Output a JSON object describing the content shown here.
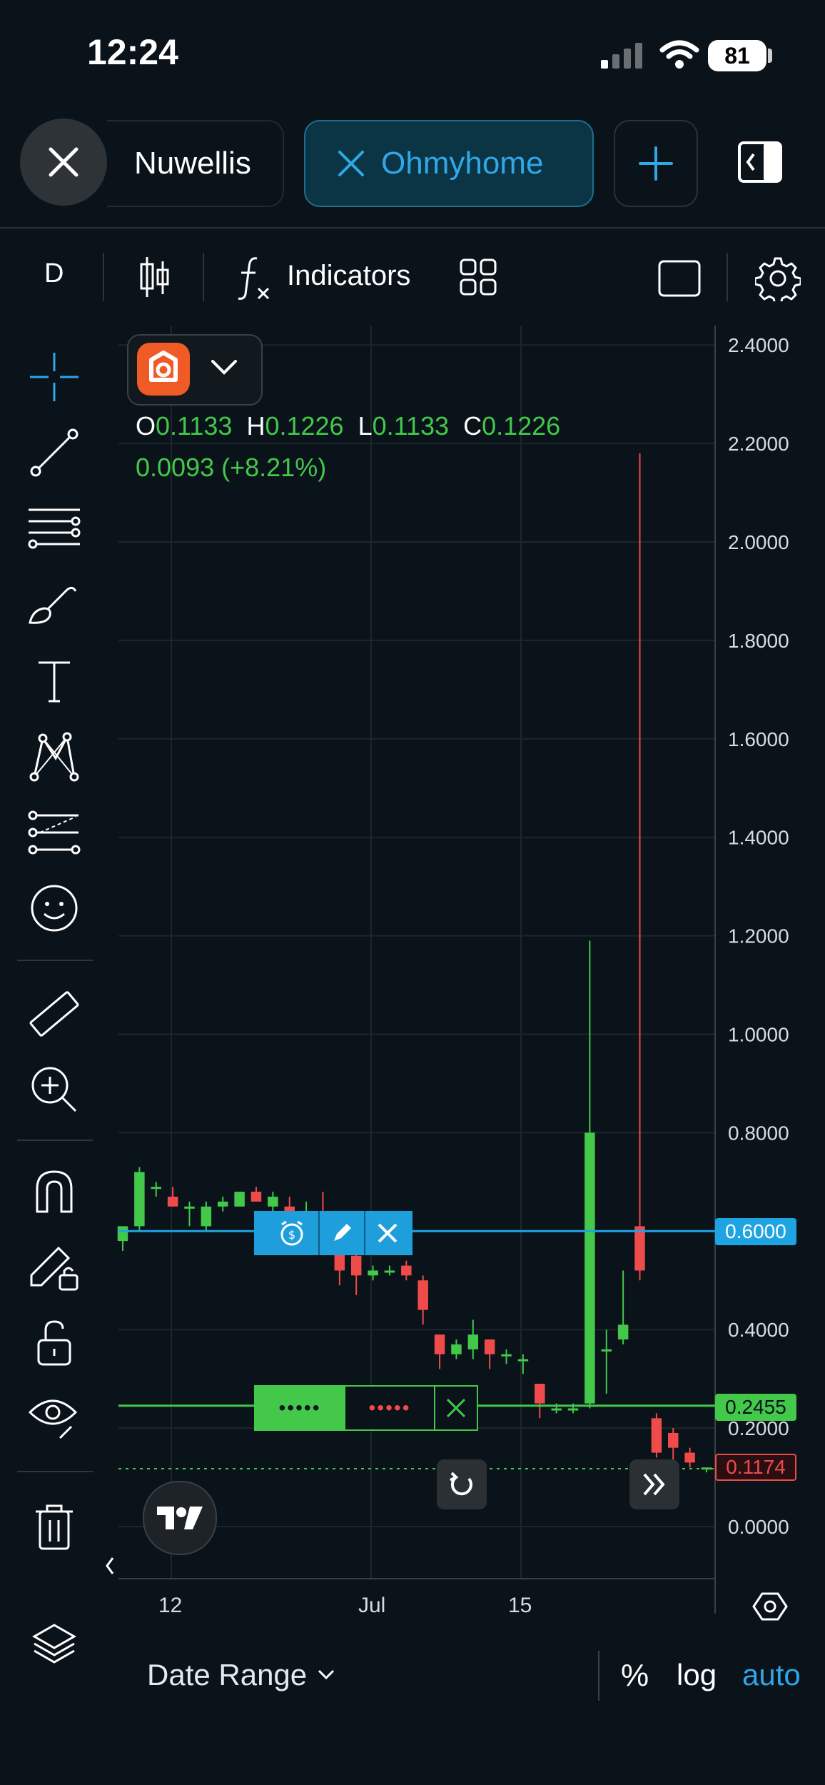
{
  "status_bar": {
    "time": "12:24",
    "battery": "81"
  },
  "tabs": [
    {
      "label": "Nuwellis",
      "active": false
    },
    {
      "label": "Ohmyhome",
      "active": true
    }
  ],
  "toolbar": {
    "interval": "D",
    "indicators_label": "Indicators"
  },
  "legend": {
    "o_label": "O",
    "o_value": "0.1133",
    "h_label": "H",
    "h_value": "0.1226",
    "l_label": "L",
    "l_value": "0.1133",
    "c_label": "C",
    "c_value": "0.1226",
    "change": "0.0093 (+8.21%)"
  },
  "axis": {
    "y_labels": [
      "2.4000",
      "2.2000",
      "2.0000",
      "1.8000",
      "1.6000",
      "1.4000",
      "1.2000",
      "1.0000",
      "0.8000",
      "0.6000",
      "0.4000",
      "0.2000",
      "0.0000"
    ],
    "x_labels": [
      "12",
      "Jul",
      "15"
    ]
  },
  "price_tags": {
    "alert": "0.6000",
    "position": "0.2455",
    "last": "0.1174"
  },
  "position_bar": {
    "left": "•••••",
    "right": "•••••"
  },
  "bottom_bar": {
    "date_range": "Date Range",
    "percent": "%",
    "log": "log",
    "auto": "auto"
  },
  "colors": {
    "up": "#43c84a",
    "down": "#ef4b4b",
    "accent": "#1ea3e3",
    "background": "#0a121a"
  },
  "chart_data": {
    "type": "candlestick",
    "ylim": [
      -0.1,
      2.4
    ],
    "y_ticks": [
      0,
      0.2,
      0.4,
      0.6,
      0.8,
      1.0,
      1.2,
      1.4,
      1.6,
      1.8,
      2.0,
      2.2,
      2.4
    ],
    "candles": [
      {
        "o": 0.58,
        "h": 0.61,
        "l": 0.56,
        "c": 0.61
      },
      {
        "o": 0.61,
        "h": 0.73,
        "l": 0.6,
        "c": 0.72
      },
      {
        "o": 0.69,
        "h": 0.7,
        "l": 0.67,
        "c": 0.69
      },
      {
        "o": 0.67,
        "h": 0.69,
        "l": 0.65,
        "c": 0.65
      },
      {
        "o": 0.65,
        "h": 0.66,
        "l": 0.61,
        "c": 0.65
      },
      {
        "o": 0.61,
        "h": 0.66,
        "l": 0.6,
        "c": 0.65
      },
      {
        "o": 0.65,
        "h": 0.67,
        "l": 0.64,
        "c": 0.66
      },
      {
        "o": 0.65,
        "h": 0.68,
        "l": 0.65,
        "c": 0.68
      },
      {
        "o": 0.68,
        "h": 0.69,
        "l": 0.66,
        "c": 0.66
      },
      {
        "o": 0.65,
        "h": 0.68,
        "l": 0.64,
        "c": 0.67
      },
      {
        "o": 0.65,
        "h": 0.67,
        "l": 0.63,
        "c": 0.64
      },
      {
        "o": 0.63,
        "h": 0.66,
        "l": 0.6,
        "c": 0.64
      },
      {
        "o": 0.62,
        "h": 0.68,
        "l": 0.59,
        "c": 0.61
      },
      {
        "o": 0.58,
        "h": 0.61,
        "l": 0.49,
        "c": 0.52
      },
      {
        "o": 0.55,
        "h": 0.56,
        "l": 0.47,
        "c": 0.51
      },
      {
        "o": 0.51,
        "h": 0.53,
        "l": 0.5,
        "c": 0.52
      },
      {
        "o": 0.52,
        "h": 0.53,
        "l": 0.51,
        "c": 0.52
      },
      {
        "o": 0.53,
        "h": 0.54,
        "l": 0.5,
        "c": 0.51
      },
      {
        "o": 0.5,
        "h": 0.51,
        "l": 0.41,
        "c": 0.44
      },
      {
        "o": 0.39,
        "h": 0.39,
        "l": 0.32,
        "c": 0.35
      },
      {
        "o": 0.35,
        "h": 0.38,
        "l": 0.34,
        "c": 0.37
      },
      {
        "o": 0.36,
        "h": 0.42,
        "l": 0.34,
        "c": 0.39
      },
      {
        "o": 0.38,
        "h": 0.38,
        "l": 0.32,
        "c": 0.35
      },
      {
        "o": 0.35,
        "h": 0.36,
        "l": 0.33,
        "c": 0.35
      },
      {
        "o": 0.34,
        "h": 0.35,
        "l": 0.31,
        "c": 0.34
      },
      {
        "o": 0.29,
        "h": 0.29,
        "l": 0.22,
        "c": 0.25
      },
      {
        "o": 0.24,
        "h": 0.25,
        "l": 0.23,
        "c": 0.24
      },
      {
        "o": 0.24,
        "h": 0.25,
        "l": 0.23,
        "c": 0.24
      },
      {
        "o": 0.25,
        "h": 1.19,
        "l": 0.24,
        "c": 0.8
      },
      {
        "o": 0.36,
        "h": 0.4,
        "l": 0.27,
        "c": 0.36
      },
      {
        "o": 0.38,
        "h": 0.52,
        "l": 0.37,
        "c": 0.41
      },
      {
        "o": 0.61,
        "h": 2.18,
        "l": 0.5,
        "c": 0.52
      },
      {
        "o": 0.22,
        "h": 0.23,
        "l": 0.14,
        "c": 0.15
      },
      {
        "o": 0.19,
        "h": 0.2,
        "l": 0.13,
        "c": 0.16
      },
      {
        "o": 0.15,
        "h": 0.16,
        "l": 0.12,
        "c": 0.13
      },
      {
        "o": 0.12,
        "h": 0.12,
        "l": 0.11,
        "c": 0.12
      }
    ],
    "alert_level": 0.6,
    "position_level": 0.2455,
    "last_price": 0.1174
  }
}
